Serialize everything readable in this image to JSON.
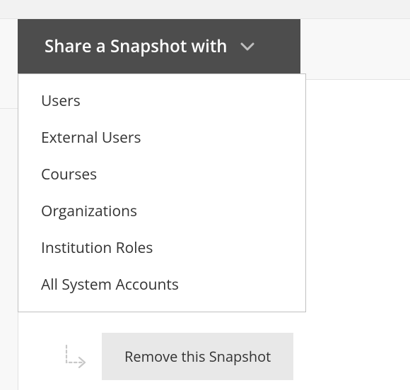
{
  "share_dropdown": {
    "button_label": "Share a Snapshot with",
    "options": [
      "Users",
      "External Users",
      "Courses",
      "Organizations",
      "Institution Roles",
      "All System Accounts"
    ]
  },
  "actions": {
    "remove_label": "Remove this Snapshot"
  }
}
